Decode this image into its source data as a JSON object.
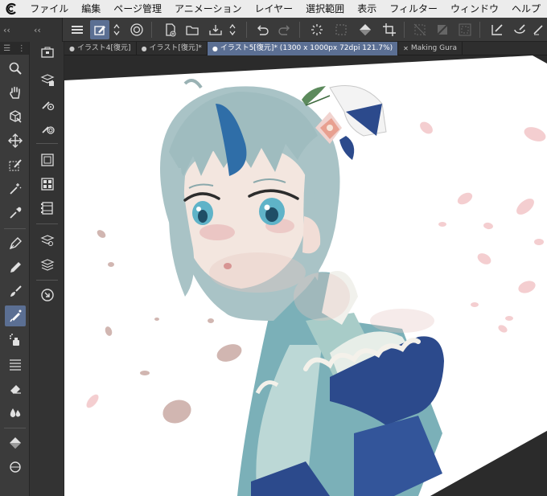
{
  "menubar": {
    "items": [
      "ファイル",
      "編集",
      "ページ管理",
      "アニメーション",
      "レイヤー",
      "選択範囲",
      "表示",
      "フィルター",
      "ウィンドウ",
      "ヘルプ"
    ]
  },
  "tabs": [
    {
      "label": "イラスト4[復元]",
      "active": false,
      "modified": true
    },
    {
      "label": "イラスト[復元]*",
      "active": false,
      "modified": true
    },
    {
      "label": "イラスト5[復元]* (1300 x 1000px 72dpi 121.7%)",
      "active": true,
      "modified": true
    },
    {
      "label": "Making Gura",
      "active": false,
      "modified": false
    }
  ],
  "panel_headers": {
    "left_collapse": "«",
    "right_collapse": "‹‹"
  },
  "tools": [
    {
      "name": "zoom-tool",
      "icon": "magnifier-icon"
    },
    {
      "name": "hand-tool",
      "icon": "hand-icon"
    },
    {
      "name": "operation-tool",
      "icon": "cube-arrow-icon"
    },
    {
      "name": "move-layer-tool",
      "icon": "move-arrows-icon"
    },
    {
      "name": "selection-tool",
      "icon": "lasso-pen-icon"
    },
    {
      "name": "auto-select-tool",
      "icon": "magic-wand-icon"
    },
    {
      "name": "eyedropper-tool",
      "icon": "eyedropper-icon"
    },
    {
      "name": "pen-tool",
      "icon": "pen-nib-icon"
    },
    {
      "name": "pencil-tool",
      "icon": "pencil-icon"
    },
    {
      "name": "brush-tool",
      "icon": "brush-icon"
    },
    {
      "name": "airbrush-tool",
      "icon": "airbrush-icon",
      "active": true
    },
    {
      "name": "decoration-tool",
      "icon": "spray-icon"
    },
    {
      "name": "lines-tool",
      "icon": "lines-icon"
    },
    {
      "name": "eraser-tool",
      "icon": "eraser-icon"
    },
    {
      "name": "blend-tool",
      "icon": "drops-icon"
    },
    {
      "name": "fill-tool",
      "icon": "bucket-icon"
    }
  ],
  "colors": {
    "menubar_bg": "#ececec",
    "toolbar_bg": "#3a3a3a",
    "panel_bg": "#3b3b3b",
    "active_accent": "#5b6f93",
    "canvas_bg": "#2b2b2b",
    "paper": "#ffffff",
    "hair": "#a9c3c6",
    "kimono_teal": "#6fa8b1",
    "ribbon_blue": "#2c4a8c",
    "petal_pink": "#f2c6c8"
  }
}
